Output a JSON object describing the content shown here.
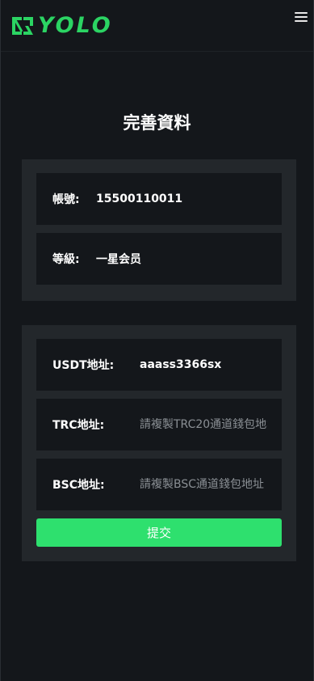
{
  "header": {
    "logo_text": "YOLO",
    "menu_icon": "hamburger-icon"
  },
  "page": {
    "title": "完善資料"
  },
  "account": {
    "account_label": "帳號:",
    "account_value": "15500110011",
    "level_label": "等級:",
    "level_value": "一星会员"
  },
  "addresses": {
    "usdt_label": "USDT地址:",
    "usdt_value": "aaass3366sx",
    "trc_label": "TRC地址:",
    "trc_placeholder": "請複製TRC20通道錢包地址",
    "bsc_label": "BSC地址:",
    "bsc_placeholder": "請複製BSC通道錢包地址",
    "submit_label": "提交"
  },
  "colors": {
    "accent": "#2ee06e",
    "background": "#14171b",
    "card": "#23272b"
  }
}
